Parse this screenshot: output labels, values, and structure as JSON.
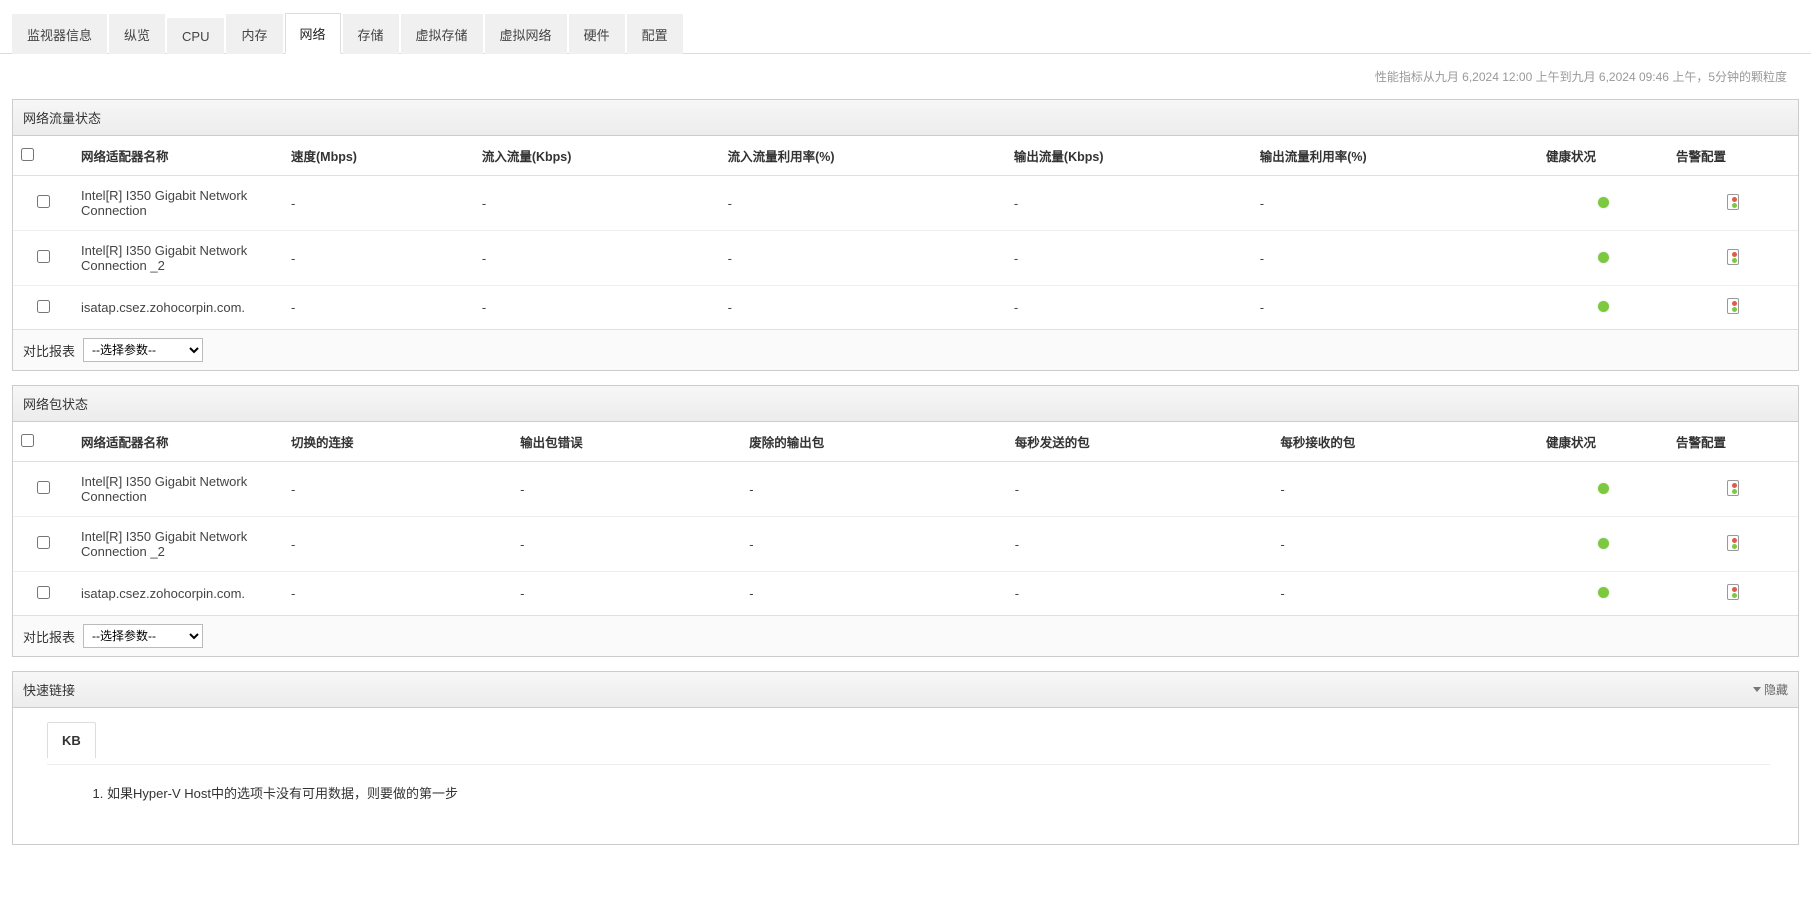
{
  "tabs": [
    {
      "label": "监视器信息"
    },
    {
      "label": "纵览"
    },
    {
      "label": "CPU"
    },
    {
      "label": "内存"
    },
    {
      "label": "网络",
      "active": true
    },
    {
      "label": "存储"
    },
    {
      "label": "虚拟存储"
    },
    {
      "label": "虚拟网络"
    },
    {
      "label": "硬件"
    },
    {
      "label": "配置"
    }
  ],
  "top_info": "性能指标从九月 6,2024 12:00 上午到九月 6,2024 09:46 上午，5分钟的颗粒度",
  "traffic_panel": {
    "title": "网络流量状态",
    "columns": [
      "网络适配器名称",
      "速度(Mbps)",
      "流入流量(Kbps)",
      "流入流量利用率(%)",
      "输出流量(Kbps)",
      "输出流量利用率(%)",
      "健康状况",
      "告警配置"
    ],
    "rows": [
      {
        "name": "Intel[R] I350 Gigabit Network Connection",
        "speed": "-",
        "in_kbps": "-",
        "in_util": "-",
        "out_kbps": "-",
        "out_util": "-"
      },
      {
        "name": "Intel[R] I350 Gigabit Network Connection _2",
        "speed": "-",
        "in_kbps": "-",
        "in_util": "-",
        "out_kbps": "-",
        "out_util": "-"
      },
      {
        "name": "isatap.csez.zohocorpin.com.",
        "speed": "-",
        "in_kbps": "-",
        "in_util": "-",
        "out_kbps": "-",
        "out_util": "-"
      }
    ],
    "footer_label": "对比报表",
    "footer_select": "--选择参数--"
  },
  "packet_panel": {
    "title": "网络包状态",
    "columns": [
      "网络适配器名称",
      "切换的连接",
      "输出包错误",
      "废除的输出包",
      "每秒发送的包",
      "每秒接收的包",
      "健康状况",
      "告警配置"
    ],
    "rows": [
      {
        "name": "Intel[R] I350 Gigabit Network Connection",
        "c1": "-",
        "c2": "-",
        "c3": "-",
        "c4": "-",
        "c5": "-"
      },
      {
        "name": "Intel[R] I350 Gigabit Network Connection _2",
        "c1": "-",
        "c2": "-",
        "c3": "-",
        "c4": "-",
        "c5": "-"
      },
      {
        "name": "isatap.csez.zohocorpin.com.",
        "c1": "-",
        "c2": "-",
        "c3": "-",
        "c4": "-",
        "c5": "-"
      }
    ],
    "footer_label": "对比报表",
    "footer_select": "--选择参数--"
  },
  "quicklinks_panel": {
    "title": "快速链接",
    "hide_label": "隐藏",
    "kb_tab": "KB",
    "items": [
      "如果Hyper-V Host中的选项卡没有可用数据，则要做的第一步"
    ]
  }
}
